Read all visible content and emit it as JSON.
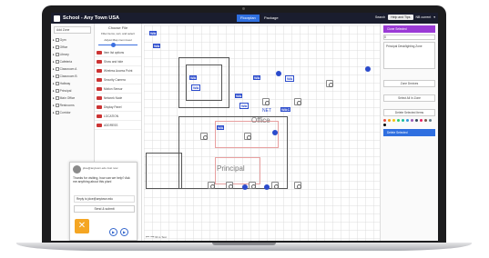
{
  "app": {
    "title": "School - Any Town USA"
  },
  "tabs": [
    {
      "label": "Floorplan"
    },
    {
      "label": "Package"
    }
  ],
  "header_right": {
    "search_label": "Search",
    "help_label": "Help and Tips",
    "account_label": "NB current"
  },
  "left_panel": {
    "add_zone_label": "Add Zone",
    "tree": [
      "Gym",
      "Office",
      "Library",
      "Cafeteria",
      "Classroom A",
      "Classroom B",
      "Hallway",
      "Principal",
      "Main Office",
      "Restrooms",
      "Corridor"
    ]
  },
  "mid_panel": {
    "title": "Choose File",
    "subtitle": "Filter items, sort, and select",
    "zoom_label": "Adjust Map zoom level",
    "rows": [
      "Item list options",
      "Show and hide",
      "Wireless Access Point",
      "Security Camera",
      "Motion Sensor",
      "Network Node",
      "Display Panel",
      "LOCATION",
      "ADDRESS"
    ]
  },
  "chat": {
    "line": "jdoe@anytown.edu Just now",
    "message": "Thanks for visiting, how can we help? Ask me anything about this plan!",
    "email_placeholder": "Reply to jdoe@anytown.edu",
    "submit_label": "Send & submit",
    "close_symbol": "✕"
  },
  "map": {
    "labels": {
      "office": "Office",
      "principal": "Principal",
      "net": "NET"
    },
    "tags": [
      "WA",
      "WA",
      "WA",
      "WA",
      "WA",
      "WA",
      "WA",
      "WA",
      "WAC",
      "WA"
    ],
    "footer": "⟵ ⟶ fill to Test"
  },
  "right_panel": {
    "clone_label": "Clone Selected",
    "input_placeholder": "0",
    "notes_label": "Principal Desk/lighting Zone",
    "buttons": [
      "Zone Devices",
      "Select All In Zone",
      "Delete Selected Items"
    ],
    "delete_label": "Delete Selected"
  },
  "colors": {
    "accent": "#2f6fe0",
    "purple": "#9b3ad6",
    "topbar": "#1a1d2e",
    "orange": "#f5a623",
    "palette": [
      "#e84c3d",
      "#f39c12",
      "#f1c40f",
      "#2ecc71",
      "#1abc9c",
      "#3498db",
      "#9b59b6",
      "#34495e",
      "#e91e63",
      "#795548",
      "#607d8b",
      "#000000"
    ]
  }
}
